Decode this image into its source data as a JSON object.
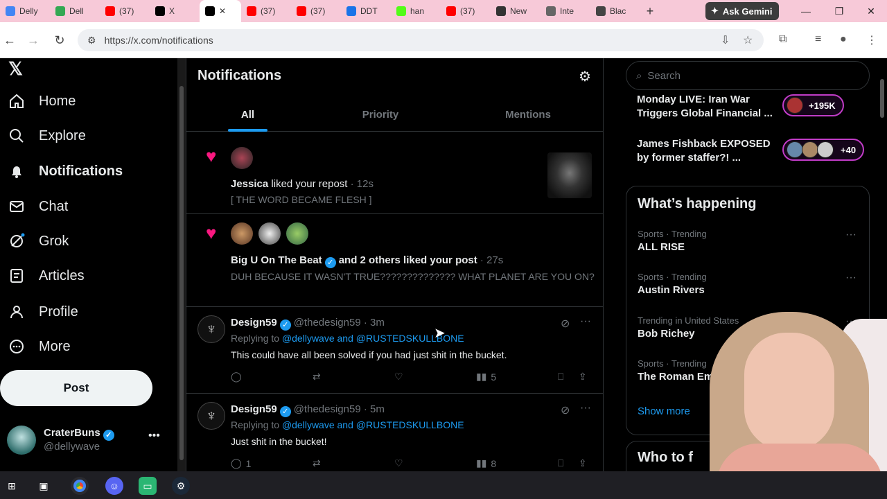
{
  "browser": {
    "tabs": [
      {
        "label": "Delly",
        "icon": "google-drive-icon",
        "color": "#4285f4"
      },
      {
        "label": "Dell",
        "icon": "google-drive-icon",
        "color": "#34a853"
      },
      {
        "label": "(37)",
        "icon": "youtube-icon",
        "color": "#ff0000"
      },
      {
        "label": "X",
        "icon": "x-icon",
        "color": "#000000"
      },
      {
        "label": "",
        "icon": "x-icon",
        "color": "#000000",
        "active": true
      },
      {
        "label": "(37)",
        "icon": "youtube-icon",
        "color": "#ff0000"
      },
      {
        "label": "(37)",
        "icon": "youtube-icon",
        "color": "#ff0000"
      },
      {
        "label": "DDT",
        "icon": "calendar-icon",
        "color": "#1a73e8"
      },
      {
        "label": "han",
        "icon": "k-icon",
        "color": "#53fc18"
      },
      {
        "label": "(37)",
        "icon": "youtube-icon",
        "color": "#ff0000"
      },
      {
        "label": "New",
        "icon": "github-icon",
        "color": "#333333"
      },
      {
        "label": "Inte",
        "icon": "globe-icon",
        "color": "#666666"
      },
      {
        "label": "Blac",
        "icon": "wix-icon",
        "color": "#444444"
      }
    ],
    "gemini_label": "Ask Gemini",
    "url": "https://x.com/notifications"
  },
  "nav": {
    "items": [
      {
        "label": "Home",
        "icon": "home-icon"
      },
      {
        "label": "Explore",
        "icon": "search-icon"
      },
      {
        "label": "Notifications",
        "icon": "bell-icon"
      },
      {
        "label": "Chat",
        "icon": "mail-icon"
      },
      {
        "label": "Grok",
        "icon": "grok-icon"
      },
      {
        "label": "Articles",
        "icon": "articles-icon"
      },
      {
        "label": "Profile",
        "icon": "person-icon"
      },
      {
        "label": "More",
        "icon": "more-circle-icon"
      }
    ],
    "post_label": "Post",
    "account": {
      "name": "CraterBuns",
      "handle": "@dellywave"
    }
  },
  "main": {
    "title": "Notifications",
    "tabs": [
      "All",
      "Priority",
      "Mentions"
    ],
    "notifications": [
      {
        "user": "Jessica",
        "action": "liked your repost",
        "time": "· 12s",
        "quote": "[ THE WORD BECAME FLESH ]"
      },
      {
        "user": "Big U On The Beat",
        "action": "and 2 others liked your post",
        "time": "· 27s",
        "quote": "DUH BECAUSE IT WASN'T TRUE??????????????  WHAT PLANET ARE YOU ON?"
      }
    ],
    "replies": [
      {
        "name": "Design59",
        "handle": "@thedesign59",
        "time": "· 3m",
        "replying_prefix": "Replying to",
        "replying_to": "@dellywave and @RUSTEDSKULLBONE",
        "text": "This could have all been solved if you had just shit in the bucket.",
        "replies": "",
        "views": "5"
      },
      {
        "name": "Design59",
        "handle": "@thedesign59",
        "time": "· 5m",
        "replying_prefix": "Replying to",
        "replying_to": "@dellywave and @RUSTEDSKULLBONE",
        "text": "Just shit in the bucket!",
        "replies": "1",
        "views": "8"
      }
    ]
  },
  "right": {
    "search_placeholder": "Search",
    "live": [
      {
        "title": "Monday LIVE: Iran War Triggers Global Financial ...",
        "count": "+195K"
      },
      {
        "title": "James Fishback EXPOSED by former staffer?! ...",
        "count": "+40"
      }
    ],
    "happening_title": "What’s happening",
    "trends": [
      {
        "category": "Sports · Trending",
        "name": "ALL RISE"
      },
      {
        "category": "Sports · Trending",
        "name": "Austin Rivers"
      },
      {
        "category": "Trending in United States",
        "name": "Bob Richey"
      },
      {
        "category": "Sports · Trending",
        "name": "The Roman Empire"
      }
    ],
    "show_more": "Show more",
    "who_to_follow": "Who to f"
  },
  "colors": {
    "accent": "#1d9bf0",
    "like": "#f91880",
    "tabbar": "#f7c9d8"
  }
}
